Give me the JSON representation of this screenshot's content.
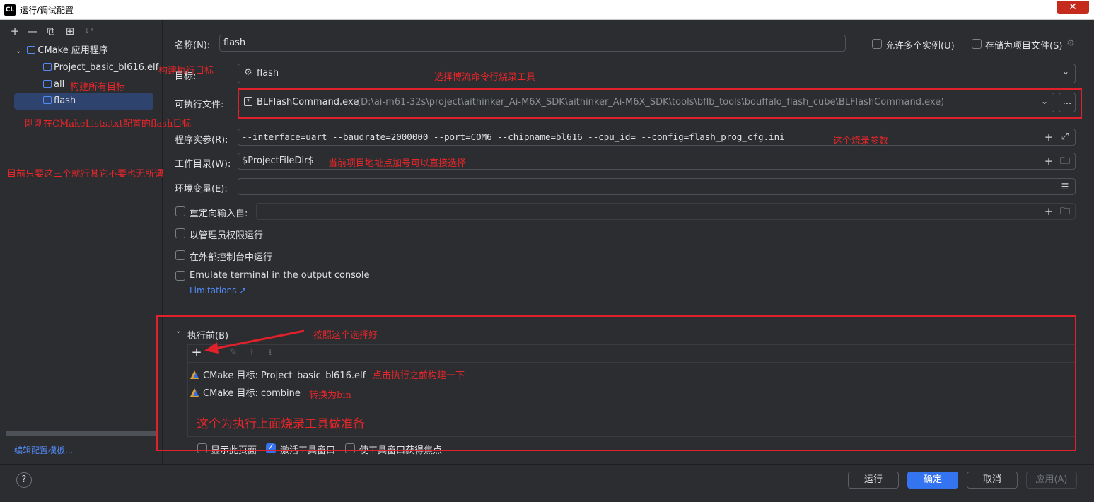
{
  "window": {
    "app_icon": "CL",
    "title": "运行/调试配置",
    "close": "✕"
  },
  "left": {
    "toolbar": [
      "+",
      "—",
      "⧉",
      "⊞",
      "↓ᵃ"
    ],
    "group_label": "CMake 应用程序",
    "items": [
      {
        "label": "Project_basic_bl616.elf"
      },
      {
        "label": "all"
      },
      {
        "label": "flash"
      }
    ],
    "edit_templates_link": "编辑配置模板..."
  },
  "form": {
    "name_label": "名称(N):",
    "name_value": "flash",
    "allow_multiple_label": "允许多个实例(U)",
    "store_as_project_label": "存储为项目文件(S)",
    "target_label": "目标:",
    "target_value": "flash",
    "executable_label": "可执行文件:",
    "executable_name": "BLFlashCommand.exe",
    "executable_path": "(D:\\ai-m61-32s\\project\\aithinker_Ai-M6X_SDK\\aithinker_Ai-M6X_SDK\\tools\\bflb_tools\\bouffalo_flash_cube\\BLFlashCommand.exe)",
    "browse_button": "...",
    "program_args_label": "程序实参(R):",
    "program_args_value": "--interface=uart --baudrate=2000000 --port=COM6 --chipname=bl616 --cpu_id= --config=flash_prog_cfg.ini",
    "working_dir_label": "工作目录(W):",
    "working_dir_value": "$ProjectFileDir$",
    "env_vars_label": "环境变量(E):",
    "redirect_input_label": "重定向输入自:",
    "run_as_admin_label": "以管理员权限运行",
    "run_external_console_label": "在外部控制台中运行",
    "emulate_terminal_label": "Emulate terminal in the output console",
    "limitations_link": "Limitations ↗"
  },
  "before_launch": {
    "header": "执行前(B)",
    "tasks": [
      {
        "label": "CMake 目标: Project_basic_bl616.elf"
      },
      {
        "label": "CMake 目标: combine"
      }
    ],
    "show_page_label": "显示此页面",
    "activate_tool_window_label": "激活工具窗口",
    "focus_tool_window_label": "使工具窗口获得焦点"
  },
  "annotations": {
    "build_exec_target": "构建执行目标",
    "build_all_targets": "构建所有目标",
    "flash_from_cmakelists": "刚刚在CMakeLists.txt配置的flash目标",
    "only_these_three": "目前只要这三个就行其它不要也无所谓",
    "choose_flash_tool": "选择博流命令行烧录工具",
    "flash_params": "这个烧录参数",
    "project_path_hint": "当前项目地址点加号可以直接选择",
    "choose_like_this": "按照这个选择好",
    "build_before_run": "点击执行之前构建一下",
    "convert_to_bin": "转换为bin",
    "prepare_for_flash": "这个为执行上面烧录工具做准备"
  },
  "footer": {
    "help": "?",
    "run": "运行",
    "ok": "确定",
    "cancel": "取消",
    "apply": "应用(A)"
  },
  "colors": {
    "background": "#2b2d30",
    "accent": "#3574f0",
    "selection": "#2e436e",
    "annotation": "#e8262a"
  }
}
